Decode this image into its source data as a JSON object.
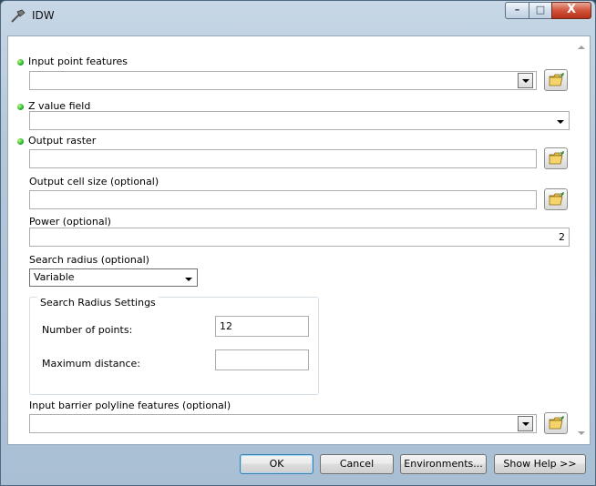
{
  "window": {
    "title": "IDW",
    "minimize_label": "–",
    "maximize_label": "□",
    "close_label": "X"
  },
  "fields": {
    "input_point_features": {
      "label": "Input point features",
      "value": ""
    },
    "z_value_field": {
      "label": "Z value field",
      "value": ""
    },
    "output_raster": {
      "label": "Output raster",
      "value": ""
    },
    "output_cell_size": {
      "label": "Output cell size (optional)",
      "value": ""
    },
    "power": {
      "label": "Power (optional)",
      "value": "2"
    },
    "search_radius": {
      "label": "Search radius (optional)",
      "value": "Variable"
    },
    "search_radius_settings": {
      "title": "Search Radius Settings",
      "number_of_points_label": "Number of points:",
      "number_of_points_value": "12",
      "maximum_distance_label": "Maximum distance:",
      "maximum_distance_value": ""
    },
    "input_barrier": {
      "label": "Input barrier polyline features (optional)",
      "value": ""
    }
  },
  "buttons": {
    "ok": "OK",
    "cancel": "Cancel",
    "environments": "Environments...",
    "show_help": "Show Help >>"
  },
  "colors": {
    "required_dot": "#29b12d",
    "default_button_border": "#3c7fb1"
  }
}
